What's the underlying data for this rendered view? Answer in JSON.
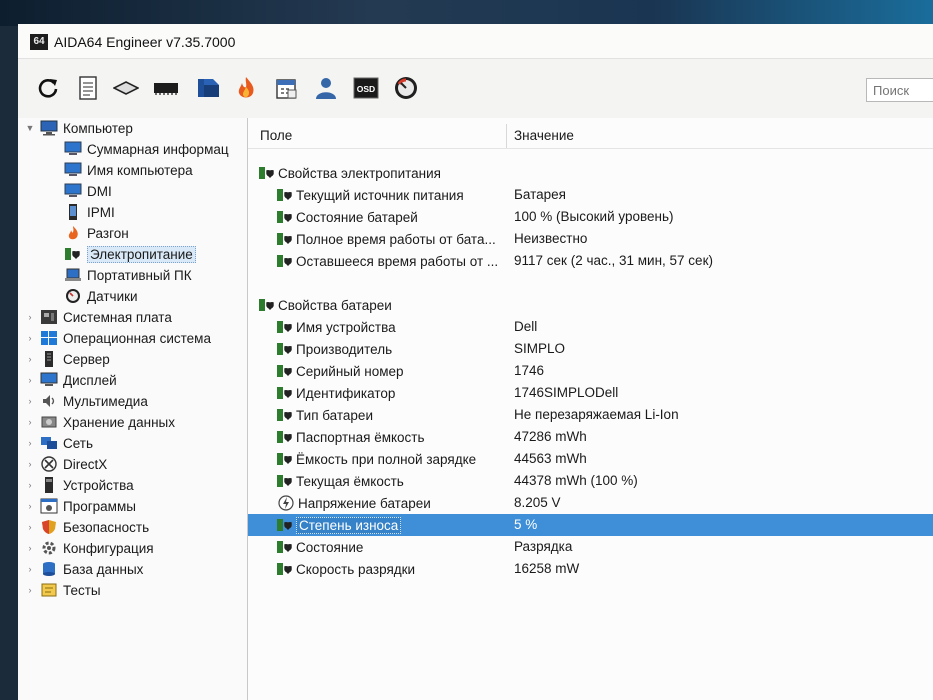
{
  "window": {
    "title": "AIDA64 Engineer v7.35.7000",
    "app_badge": "64"
  },
  "toolbar": {
    "buttons": [
      {
        "name": "refresh-button",
        "icon": "refresh-icon"
      },
      {
        "name": "report-button",
        "icon": "report-icon"
      },
      {
        "name": "motherboard-button",
        "icon": "motherboard-icon"
      },
      {
        "name": "memory-button",
        "icon": "memory-icon"
      },
      {
        "name": "network-button",
        "icon": "network-icon"
      },
      {
        "name": "flame-button",
        "icon": "flame-icon"
      },
      {
        "name": "calendar-button",
        "icon": "calendar-icon"
      },
      {
        "name": "user-button",
        "icon": "user-icon"
      },
      {
        "name": "osd-button",
        "icon": "osd-icon",
        "label": "OSD"
      },
      {
        "name": "gauge-button",
        "icon": "gauge-icon"
      }
    ],
    "search_placeholder": "Поиск"
  },
  "sidebar": {
    "computer": {
      "label": "Компьютер",
      "expanded": true
    },
    "computer_children": [
      {
        "label": "Суммарная информац",
        "icon": "monitor-icon"
      },
      {
        "label": "Имя компьютера",
        "icon": "monitor-icon"
      },
      {
        "label": "DMI",
        "icon": "monitor-icon"
      },
      {
        "label": "IPMI",
        "icon": "phone-icon"
      },
      {
        "label": "Разгон",
        "icon": "flame-icon"
      },
      {
        "label": "Электропитание",
        "icon": "power-icon",
        "selected": true
      },
      {
        "label": "Портативный ПК",
        "icon": "laptop-icon"
      },
      {
        "label": "Датчики",
        "icon": "gauge-icon"
      }
    ],
    "categories": [
      {
        "label": "Системная плата",
        "icon": "motherboard-icon"
      },
      {
        "label": "Операционная система",
        "icon": "windows-icon"
      },
      {
        "label": "Сервер",
        "icon": "server-icon"
      },
      {
        "label": "Дисплей",
        "icon": "display-icon"
      },
      {
        "label": "Мультимедиа",
        "icon": "multimedia-icon"
      },
      {
        "label": "Хранение данных",
        "icon": "storage-icon"
      },
      {
        "label": "Сеть",
        "icon": "network-icon"
      },
      {
        "label": "DirectX",
        "icon": "xbox-icon"
      },
      {
        "label": "Устройства",
        "icon": "devices-icon"
      },
      {
        "label": "Программы",
        "icon": "programs-icon"
      },
      {
        "label": "Безопасность",
        "icon": "shield-icon"
      },
      {
        "label": "Конфигурация",
        "icon": "config-icon"
      },
      {
        "label": "База данных",
        "icon": "database-icon"
      },
      {
        "label": "Тесты",
        "icon": "tests-icon"
      }
    ]
  },
  "content": {
    "header": {
      "field": "Поле",
      "value": "Значение"
    },
    "groups": [
      {
        "title": "Свойства электропитания",
        "rows": [
          {
            "field": "Текущий источник питания",
            "value": "Батарея"
          },
          {
            "field": "Состояние батарей",
            "value": "100 % (Высокий уровень)"
          },
          {
            "field": "Полное время работы от бата...",
            "value": "Неизвестно"
          },
          {
            "field": "Оставшееся время работы от ...",
            "value": "9117 сек (2 час., 31 мин, 57 сек)"
          }
        ]
      },
      {
        "title": "Свойства батареи",
        "rows": [
          {
            "field": "Имя устройства",
            "value": "Dell"
          },
          {
            "field": "Производитель",
            "value": "SIMPLO"
          },
          {
            "field": "Серийный номер",
            "value": "1746"
          },
          {
            "field": "Идентификатор",
            "value": "1746SIMPLODell"
          },
          {
            "field": "Тип батареи",
            "value": "Не перезаряжаемая Li-Ion"
          },
          {
            "field": "Паспортная ёмкость",
            "value": "47286 mWh"
          },
          {
            "field": "Ёмкость при полной зарядке",
            "value": "44563 mWh"
          },
          {
            "field": "Текущая ёмкость",
            "value": "44378 mWh  (100 %)"
          },
          {
            "field": "Напряжение батареи",
            "value": "8.205 V",
            "icon": "voltage-icon"
          },
          {
            "field": "Степень износа",
            "value": "5 %",
            "selected": true
          },
          {
            "field": "Состояние",
            "value": "Разрядка"
          },
          {
            "field": "Скорость разрядки",
            "value": "16258 mW"
          }
        ]
      }
    ]
  }
}
